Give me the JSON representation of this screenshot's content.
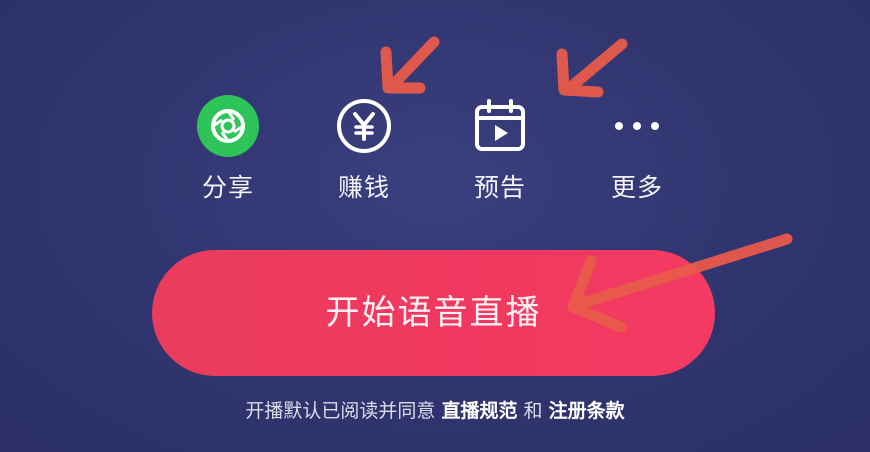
{
  "actions": [
    {
      "label": "分享",
      "icon": "share-camera-icon"
    },
    {
      "label": "赚钱",
      "icon": "yuan-coin-icon"
    },
    {
      "label": "预告",
      "icon": "calendar-play-icon"
    },
    {
      "label": "更多",
      "icon": "more-dots-icon"
    }
  ],
  "start_button": {
    "label": "开始语音直播"
  },
  "agreement": {
    "prefix": "开播默认已阅读并同意 ",
    "link1": "直播规范",
    "middle": " 和 ",
    "link2": "注册条款"
  },
  "colors": {
    "background": "#323671",
    "button": "#f0395f",
    "share_icon": "#2fc45a",
    "annotation_arrow": "#e85a4a"
  },
  "annotations": [
    "red-arrow-earn",
    "red-arrow-preview",
    "red-arrow-start-button"
  ]
}
